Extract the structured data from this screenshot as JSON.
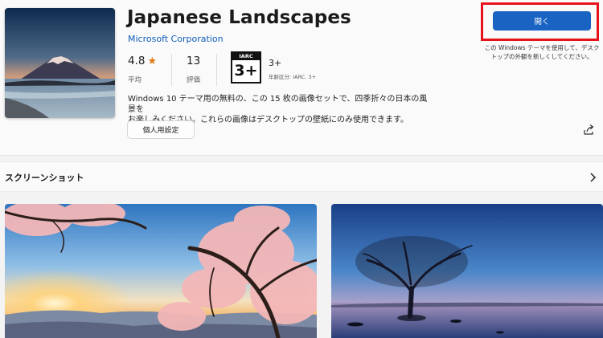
{
  "app": {
    "title": "Japanese Landscapes",
    "publisher": "Microsoft Corporation",
    "rating": {
      "value": "4.8",
      "label": "平均"
    },
    "reviews": {
      "value": "13",
      "label": "評価"
    },
    "age": {
      "badge_top": "IARC",
      "badge_value": "3+",
      "value": "3+",
      "note": "年齢区分: IARC. 3+"
    },
    "description_lines": [
      "Windows 10 テーマ用の無料の、この 15 枚の画像セットで、四季折々の日本の風景を",
      "お楽しみください。これらの画像はデスクトップの壁紙にのみ使用できます。"
    ],
    "settings_button": "個人用設定"
  },
  "action": {
    "open_button": "開く",
    "note_lines": [
      "この Windows テーマを使用して、デスク",
      "トップの外観を新しくしてください。"
    ],
    "highlight_color": "#e8121b",
    "button_color": "#1a63c2"
  },
  "screenshots": {
    "title": "スクリーンショット",
    "items": [
      {
        "subject": "cherry blossom tree at sunrise over mountains"
      },
      {
        "subject": "lone tree in lake at twilight"
      }
    ]
  },
  "icons": [
    "star-icon",
    "share-icon",
    "chevron-right-icon"
  ]
}
